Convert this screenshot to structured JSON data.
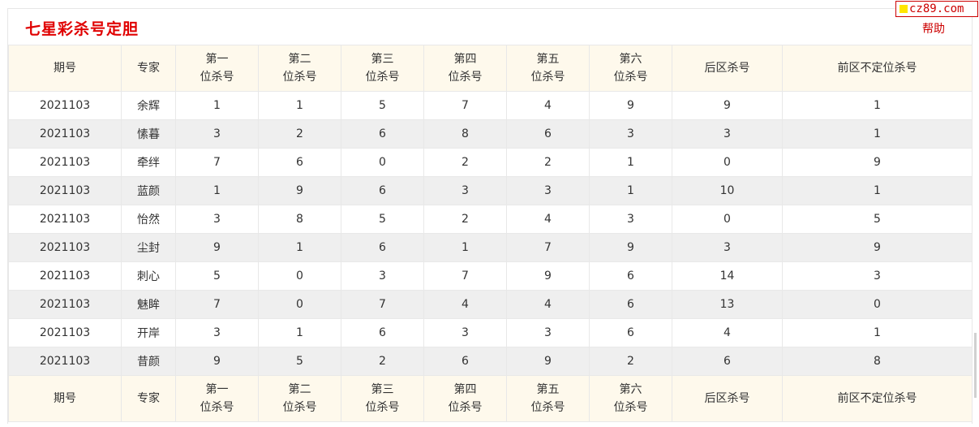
{
  "title": "七星彩杀号定胆",
  "watermark": "cz89.com",
  "help_label": "帮助",
  "columns": [
    {
      "l1": "期号",
      "l2": ""
    },
    {
      "l1": "专家",
      "l2": ""
    },
    {
      "l1": "第一",
      "l2": "位杀号"
    },
    {
      "l1": "第二",
      "l2": "位杀号"
    },
    {
      "l1": "第三",
      "l2": "位杀号"
    },
    {
      "l1": "第四",
      "l2": "位杀号"
    },
    {
      "l1": "第五",
      "l2": "位杀号"
    },
    {
      "l1": "第六",
      "l2": "位杀号"
    },
    {
      "l1": "后区杀号",
      "l2": ""
    },
    {
      "l1": "前区不定位杀号",
      "l2": ""
    }
  ],
  "rows": [
    [
      "2021103",
      "余辉",
      "1",
      "1",
      "5",
      "7",
      "4",
      "9",
      "9",
      "1"
    ],
    [
      "2021103",
      "愫暮",
      "3",
      "2",
      "6",
      "8",
      "6",
      "3",
      "3",
      "1"
    ],
    [
      "2021103",
      "牵绊",
      "7",
      "6",
      "0",
      "2",
      "2",
      "1",
      "0",
      "9"
    ],
    [
      "2021103",
      "蓝颜",
      "1",
      "9",
      "6",
      "3",
      "3",
      "1",
      "10",
      "1"
    ],
    [
      "2021103",
      "怡然",
      "3",
      "8",
      "5",
      "2",
      "4",
      "3",
      "0",
      "5"
    ],
    [
      "2021103",
      "尘封",
      "9",
      "1",
      "6",
      "1",
      "7",
      "9",
      "3",
      "9"
    ],
    [
      "2021103",
      "刺心",
      "5",
      "0",
      "3",
      "7",
      "9",
      "6",
      "14",
      "3"
    ],
    [
      "2021103",
      "魅眸",
      "7",
      "0",
      "7",
      "4",
      "4",
      "6",
      "13",
      "0"
    ],
    [
      "2021103",
      "开岸",
      "3",
      "1",
      "6",
      "3",
      "3",
      "6",
      "4",
      "1"
    ],
    [
      "2021103",
      "昔颜",
      "9",
      "5",
      "2",
      "6",
      "9",
      "2",
      "6",
      "8"
    ]
  ]
}
